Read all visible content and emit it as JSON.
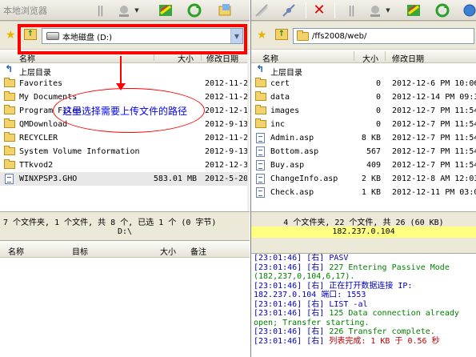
{
  "left_toolbar": {
    "title": "本地浏览器"
  },
  "left_address": {
    "drive_label": "本地磁盘  (D:)"
  },
  "right_address": {
    "path": "/ffs2008/web/"
  },
  "left_list": {
    "columns": [
      "名称",
      "大小",
      "修改日期"
    ],
    "up_label": "上层目录",
    "rows": [
      {
        "name": "Favorites",
        "size": "",
        "date": "2012-11-2",
        "type": "folder"
      },
      {
        "name": "My Documents",
        "size": "",
        "date": "2012-11-2",
        "type": "folder"
      },
      {
        "name": "Program Files",
        "size": "",
        "date": "2012-12-1",
        "type": "folder"
      },
      {
        "name": "QMDownload",
        "size": "",
        "date": "2012-9-13",
        "type": "folder"
      },
      {
        "name": "RECYCLER",
        "size": "",
        "date": "2012-11-2",
        "type": "folder"
      },
      {
        "name": "System Volume Information",
        "size": "",
        "date": "2012-9-13",
        "type": "folder"
      },
      {
        "name": "TTkvod2",
        "size": "",
        "date": "2012-12-3",
        "type": "folder"
      },
      {
        "name": "WINXPSP3.GHO",
        "size": "583.01 MB",
        "date": "2012-5-20",
        "type": "file"
      }
    ],
    "status": "7 个文件夹, 1 个文件, 共 8 个, 已选 1 个 (0 字节)",
    "current_path": "D:\\"
  },
  "right_list": {
    "columns": [
      "名称",
      "大小",
      "修改日期"
    ],
    "up_label": "上层目录",
    "rows": [
      {
        "name": "cert",
        "size": "0",
        "date": "2012-12-6 PM 10:06",
        "type": "folder"
      },
      {
        "name": "data",
        "size": "0",
        "date": "2012-12-14 PM 09:3",
        "type": "folder"
      },
      {
        "name": "images",
        "size": "0",
        "date": "2012-12-7 PM 11:54",
        "type": "folder"
      },
      {
        "name": "inc",
        "size": "0",
        "date": "2012-12-7 PM 11:54",
        "type": "folder"
      },
      {
        "name": "Admin.asp",
        "size": "8 KB",
        "date": "2012-12-7 PM 11:54",
        "type": "file"
      },
      {
        "name": "Bottom.asp",
        "size": "567",
        "date": "2012-12-7 PM 11:54",
        "type": "file"
      },
      {
        "name": "Buy.asp",
        "size": "409",
        "date": "2012-12-7 PM 11:54",
        "type": "file"
      },
      {
        "name": "ChangeInfo.asp",
        "size": "2 KB",
        "date": "2012-12-8 AM 12:03",
        "type": "file"
      },
      {
        "name": "Check.asp",
        "size": "1 KB",
        "date": "2012-12-11 PM 03:0",
        "type": "file"
      }
    ],
    "status": "4 个文件夹, 22 个文件, 共 26 (60 KB)",
    "ip": "182.237.0.104"
  },
  "queue": {
    "columns": [
      "名称",
      "目标",
      "大小",
      "备注"
    ]
  },
  "log": [
    {
      "time": "[23:01:46]",
      "src": "[右]",
      "msg": "PASV",
      "color": "t"
    },
    {
      "time": "[23:01:46]",
      "src": "[右]",
      "msg": "227 Entering Passive Mode",
      "color": "g"
    },
    {
      "time": "",
      "src": "",
      "msg": "(182,237,0,104,6,17).",
      "color": "g"
    },
    {
      "time": "[23:01:46]",
      "src": "[右]",
      "msg": "正在打开数据连接 IP:",
      "color": "t"
    },
    {
      "time": "",
      "src": "",
      "msg": "182.237.0.104 端口: 1553",
      "color": "t"
    },
    {
      "time": "[23:01:46]",
      "src": "[右]",
      "msg": "LIST -al",
      "color": "t"
    },
    {
      "time": "[23:01:46]",
      "src": "[右]",
      "msg": "125 Data connection already",
      "color": "g"
    },
    {
      "time": "",
      "src": "",
      "msg": "open; Transfer starting.",
      "color": "g"
    },
    {
      "time": "[23:01:46]",
      "src": "[右]",
      "msg": "226 Transfer complete.",
      "color": "g"
    },
    {
      "time": "[23:01:46]",
      "src": "[右]",
      "msg": "列表完成: 1 KB 于 0.56 秒",
      "color": "r"
    }
  ],
  "annotation": {
    "text": "这里选择需要上传文件的路径"
  },
  "colors": {
    "annotation_red": "#ff0000",
    "annotation_blue": "#0000ff",
    "ip_highlight": "#ffff80"
  }
}
